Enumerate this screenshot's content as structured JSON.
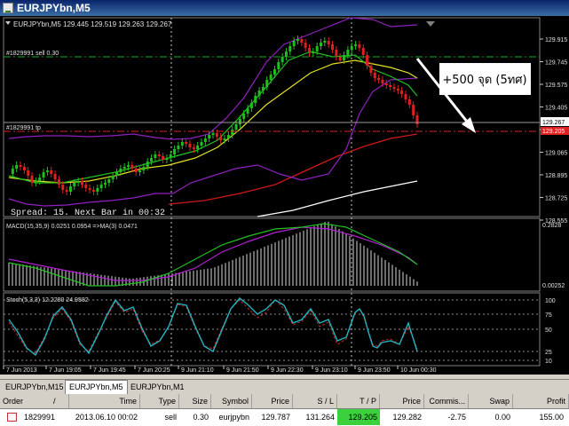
{
  "window": {
    "title": "EURJPYbn,M5"
  },
  "chart": {
    "header": "EURJPYbn,M5  129.445 129.519 129.263 129.267",
    "sl_line_label": "#1829991 sell 0.30",
    "tp_line_label": "#1829991 tp",
    "current_price": "129.267",
    "tp_price": "129.205",
    "spread_text": "Spread: 15. Next Bar in 00:32",
    "annotation": "+500 จุด (5ทศ)",
    "price_axis": [
      "129.915",
      "129.745",
      "129.575",
      "129.405",
      "129.235",
      "129.065",
      "128.895",
      "128.725",
      "128.555"
    ],
    "macd_label": "MACD(15,35,9) 0.0251 0.0954 =>MA(3) 0.0471",
    "macd_axis_top": "0.2828",
    "macd_axis_bottom": "0.00252",
    "stoch_label": "Stoch(5,3,3) 12.2280 24.9582",
    "stoch_axis": [
      "100",
      "75",
      "50",
      "25",
      "10"
    ],
    "time_axis": [
      "7 Jun 2013",
      "7 Jun 19:05",
      "7 Jun 19:45",
      "7 Jun 20:25",
      "9 Jun 21:10",
      "9 Jun 21:50",
      "9 Jun 22:30",
      "9 Jun 23:10",
      "9 Jun 23:50",
      "10 Jun 00:30"
    ],
    "colors": {
      "background": "#000000",
      "bull": "#1fbf1f",
      "bear": "#e02020",
      "sl_line": "#1aa81a",
      "tp_line": "#e02020",
      "axis": "#c8c8c8"
    }
  },
  "tabs": [
    "EURJPYbn,M15",
    "EURJPYbn,M5",
    "EURJPYbn,M1"
  ],
  "active_tab": "EURJPYbn,M5",
  "orders": {
    "columns": [
      "Order",
      "/",
      "Time",
      "Type",
      "Size",
      "Symbol",
      "Price",
      "S / L",
      "T / P",
      "Price",
      "Commis...",
      "Swap",
      "Profit"
    ],
    "rows": [
      {
        "order": "1829991",
        "time": "2013.06.10 00:02",
        "type": "sell",
        "size": "0.30",
        "symbol": "eurjpybn",
        "price": "129.787",
        "sl": "131.264",
        "tp": "129.205",
        "cur_price": "129.282",
        "commission": "-2.75",
        "swap": "0.00",
        "profit": "155.00"
      }
    ]
  }
}
